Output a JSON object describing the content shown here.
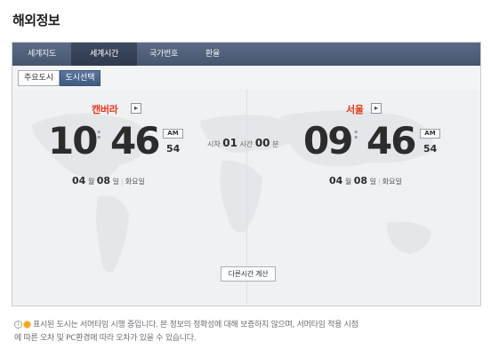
{
  "page": {
    "title": "해외정보"
  },
  "tabs": [
    {
      "label": "세계지도"
    },
    {
      "label": "세계시간"
    },
    {
      "label": "국가번호"
    },
    {
      "label": "환율"
    }
  ],
  "subtabs": [
    {
      "label": "주요도시"
    },
    {
      "label": "도시선택"
    }
  ],
  "left_clock": {
    "city": "캔버라",
    "hour": "10",
    "minute": "46",
    "ampm": "AM",
    "second": "54",
    "month": "04",
    "month_unit": "월",
    "day": "08",
    "day_unit": "일",
    "weekday": "화요일"
  },
  "right_clock": {
    "city": "서울",
    "hour": "09",
    "minute": "46",
    "ampm": "AM",
    "second": "54",
    "month": "04",
    "month_unit": "월",
    "day": "08",
    "day_unit": "일",
    "weekday": "화요일"
  },
  "time_diff": {
    "prefix": "시차",
    "hours": "01",
    "hours_unit": "시간",
    "minutes": "00",
    "minutes_unit": "분"
  },
  "calc_button": {
    "label": "다른시간 계산"
  },
  "note": {
    "line1": "표시된 도시는 서머타임 시행 중입니다. 본 정보의 정확성에 대해 보증하지 않으며, 서머타임 적용 시점",
    "line2": "에 따른 오차 및 PC환경에 따라 오차가 있을 수 있습니다."
  },
  "colors": {
    "accent_red": "#e8381e",
    "tab_bg": "#4f5f7a",
    "tab_active": "#354157"
  }
}
